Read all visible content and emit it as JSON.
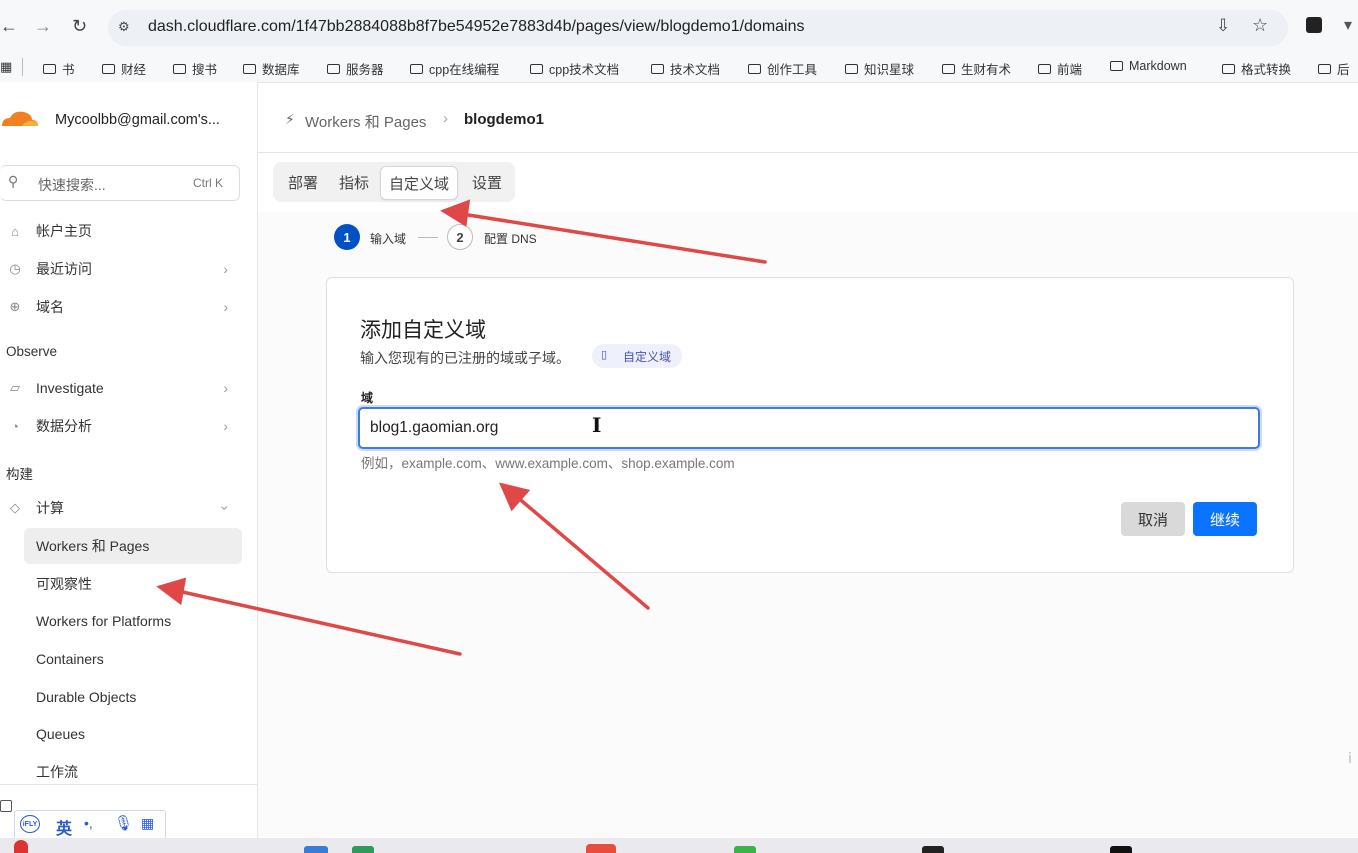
{
  "browser": {
    "url": "dash.cloudflare.com/1f47bb2884088b8f7be54952e7883d4b/pages/view/blogdemo1/domains",
    "bookmarks": [
      "书",
      "财经",
      "搜书",
      "数据库",
      "服务器",
      "cpp在线编程",
      "cpp技术文档",
      "技术文档",
      "创作工具",
      "知识星球",
      "生财有术",
      "前端",
      "Markdown",
      "格式转换",
      "后"
    ]
  },
  "account": {
    "name": "Mycoolbb@gmail.com's..."
  },
  "search": {
    "placeholder": "快速搜索...",
    "shortcut": "Ctrl K"
  },
  "sidebar": {
    "top_items": [
      {
        "label": "帐户主页",
        "icon": "home-icon"
      },
      {
        "label": "最近访问",
        "icon": "clock-icon"
      },
      {
        "label": "域名",
        "icon": "globe-icon"
      }
    ],
    "observe_label": "Observe",
    "observe_items": [
      {
        "label": "Investigate",
        "icon": "investigate-icon"
      },
      {
        "label": "数据分析",
        "icon": "analytics-icon"
      }
    ],
    "build_label": "构建",
    "compute_label": "计算",
    "compute_items": [
      "Workers 和 Pages",
      "可观察性",
      "Workers for Platforms",
      "Containers",
      "Durable Objects",
      "Queues",
      "工作流"
    ]
  },
  "breadcrumb": {
    "parent": "Workers 和 Pages",
    "current": "blogdemo1"
  },
  "tabs": [
    "部署",
    "指标",
    "自定义域",
    "设置"
  ],
  "steps": [
    {
      "num": "1",
      "label": "输入域"
    },
    {
      "num": "2",
      "label": "配置 DNS"
    }
  ],
  "card": {
    "title": "添加自定义域",
    "description": "输入您现有的已注册的域或子域。",
    "doc_link": "自定义域",
    "field_label": "域",
    "field_value": "blog1.gaomian.org",
    "hint": "例如，example.com、www.example.com、shop.example.com",
    "cancel": "取消",
    "continue": "继续"
  },
  "ime": {
    "lang": "英"
  },
  "colors": {
    "accent": "#0051c3",
    "primary_button": "#0a73ff",
    "annotation_arrow": "#e04848"
  }
}
